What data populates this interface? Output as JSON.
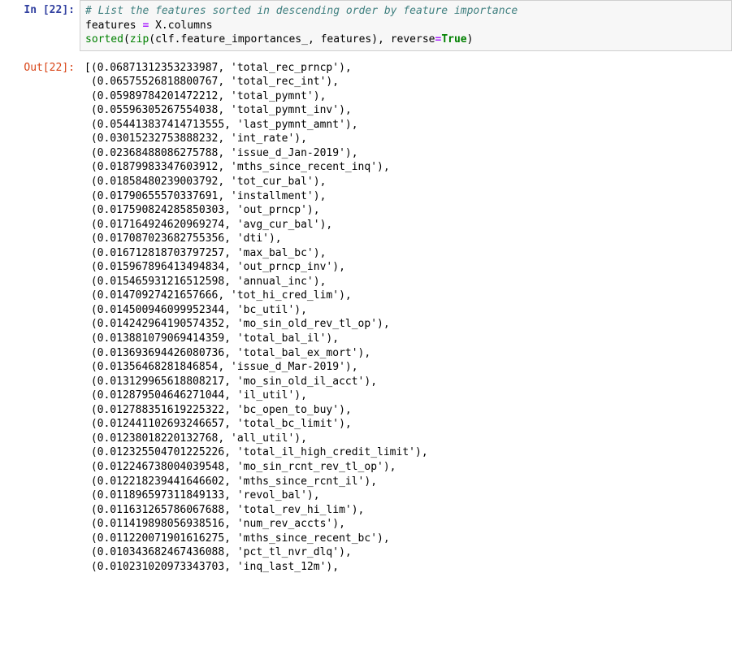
{
  "cell": {
    "in_prompt": "In [22]:",
    "out_prompt": "Out[22]:",
    "code": {
      "comment": "# List the features sorted in descending order by feature importance",
      "l2_lhs": "features ",
      "l2_op": "=",
      "l2_rhs": " X.columns",
      "l3_builtin1": "sorted",
      "l3_open1": "(",
      "l3_builtin2": "zip",
      "l3_open2": "(",
      "l3_mid": "clf.feature_importances_, features",
      "l3_close2": ")",
      "l3_comma": ", reverse",
      "l3_eq": "=",
      "l3_true": "True",
      "l3_close1": ")"
    }
  },
  "output": {
    "rows": [
      {
        "v": "0.06871312353233987",
        "f": "total_rec_prncp"
      },
      {
        "v": "0.06575526818800767",
        "f": "total_rec_int"
      },
      {
        "v": "0.05989784201472212",
        "f": "total_pymnt"
      },
      {
        "v": "0.05596305267554038",
        "f": "total_pymnt_inv"
      },
      {
        "v": "0.054413837414713555",
        "f": "last_pymnt_amnt"
      },
      {
        "v": "0.03015232753888232",
        "f": "int_rate"
      },
      {
        "v": "0.02368488086275788",
        "f": "issue_d_Jan-2019"
      },
      {
        "v": "0.01879983347603912",
        "f": "mths_since_recent_inq"
      },
      {
        "v": "0.01858480239003792",
        "f": "tot_cur_bal"
      },
      {
        "v": "0.01790655570337691",
        "f": "installment"
      },
      {
        "v": "0.017590824285850303",
        "f": "out_prncp"
      },
      {
        "v": "0.017164924620969274",
        "f": "avg_cur_bal"
      },
      {
        "v": "0.017087023682755356",
        "f": "dti"
      },
      {
        "v": "0.016712818703797257",
        "f": "max_bal_bc"
      },
      {
        "v": "0.015967896413494834",
        "f": "out_prncp_inv"
      },
      {
        "v": "0.015465931216512598",
        "f": "annual_inc"
      },
      {
        "v": "0.01470927421657666",
        "f": "tot_hi_cred_lim"
      },
      {
        "v": "0.014500946099952344",
        "f": "bc_util"
      },
      {
        "v": "0.014242964190574352",
        "f": "mo_sin_old_rev_tl_op"
      },
      {
        "v": "0.013881079069414359",
        "f": "total_bal_il"
      },
      {
        "v": "0.013693694426080736",
        "f": "total_bal_ex_mort"
      },
      {
        "v": "0.01356468281846854",
        "f": "issue_d_Mar-2019"
      },
      {
        "v": "0.013129965618808217",
        "f": "mo_sin_old_il_acct"
      },
      {
        "v": "0.012879504646271044",
        "f": "il_util"
      },
      {
        "v": "0.012788351619225322",
        "f": "bc_open_to_buy"
      },
      {
        "v": "0.012441102693246657",
        "f": "total_bc_limit"
      },
      {
        "v": "0.01238018220132768",
        "f": "all_util"
      },
      {
        "v": "0.012325504701225226",
        "f": "total_il_high_credit_limit"
      },
      {
        "v": "0.012246738004039548",
        "f": "mo_sin_rcnt_rev_tl_op"
      },
      {
        "v": "0.012218239441646602",
        "f": "mths_since_rcnt_il"
      },
      {
        "v": "0.011896597311849133",
        "f": "revol_bal"
      },
      {
        "v": "0.011631265786067688",
        "f": "total_rev_hi_lim"
      },
      {
        "v": "0.011419898056938516",
        "f": "num_rev_accts"
      },
      {
        "v": "0.011220071901616275",
        "f": "mths_since_recent_bc"
      },
      {
        "v": "0.010343682467436088",
        "f": "pct_tl_nvr_dlq"
      },
      {
        "v": "0.010231020973343703",
        "f": "inq_last_12m",
        "cut": true
      }
    ]
  }
}
